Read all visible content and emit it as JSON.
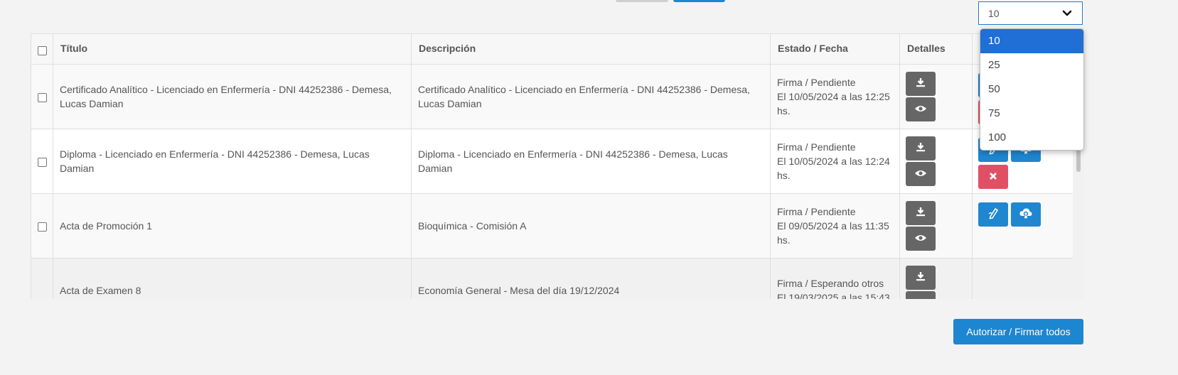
{
  "page_size": {
    "value": "10",
    "options": [
      "10",
      "25",
      "50",
      "75",
      "100"
    ],
    "selected_index": 0
  },
  "table": {
    "headers": {
      "titulo": "Título",
      "descripcion": "Descripción",
      "estado": "Estado / Fecha",
      "detalles": "Detalles"
    },
    "rows": [
      {
        "titulo": "Certificado Analítico - Licenciado en Enfermería - DNI 44252386 - Demesa, Lucas Damian",
        "descripcion": "Certificado Analítico - Licenciado en Enfermería - DNI 44252386 - Demesa, Lucas Damian",
        "estado": "Firma / Pendiente",
        "fecha": "El 10/05/2024 a las 12:25 hs."
      },
      {
        "titulo": "Diploma - Licenciado en Enfermería - DNI 44252386 - Demesa, Lucas Damian",
        "descripcion": "Diploma - Licenciado en Enfermería - DNI 44252386 - Demesa, Lucas Damian",
        "estado": "Firma / Pendiente",
        "fecha": "El 10/05/2024 a las 12:24 hs."
      },
      {
        "titulo": "Acta de Promoción 1",
        "descripcion": "Bioquímica - Comisión A",
        "estado": "Firma / Pendiente",
        "fecha": "El 09/05/2024 a las 11:35 hs."
      },
      {
        "titulo": "Acta de Examen 8",
        "descripcion": "Economía General - Mesa del día 19/12/2024",
        "estado": "Firma / Esperando otros",
        "fecha": "El 19/03/2025 a las 15:43"
      }
    ]
  },
  "footer": {
    "sign_all_label": "Autorizar / Firmar todos"
  },
  "colors": {
    "primary": "#1d86d1",
    "danger": "#e05064",
    "dark_button": "#666666",
    "selected_option": "#1f6fd6"
  },
  "icons": {
    "download": "download-icon",
    "view": "eye-icon",
    "sign": "pen-icon",
    "certificate": "cloud-certificate-icon",
    "reject": "close-icon"
  }
}
